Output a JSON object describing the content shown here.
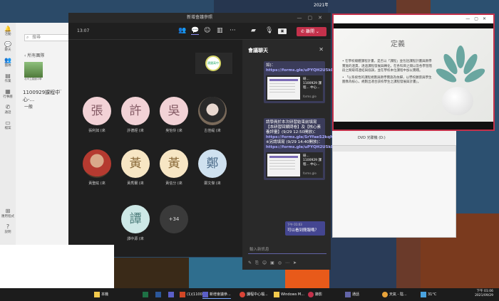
{
  "colors": {
    "accent": "#5b5fc7",
    "leave_red": "#c4314b",
    "chat_bubble": "#3b3c5a",
    "my_bubble": "#444691"
  },
  "desktop": {
    "top_date": "2021年09月"
  },
  "teams": {
    "search_placeholder": "搜尋",
    "rail": [
      {
        "icon": "bell-icon",
        "label": "活動"
      },
      {
        "icon": "chat-icon",
        "label": "聊天"
      },
      {
        "icon": "teams-icon",
        "label": "團隊"
      },
      {
        "icon": "assignments-icon",
        "label": "作業"
      },
      {
        "icon": "calendar-icon",
        "label": "行事曆"
      },
      {
        "icon": "phone-icon",
        "label": "通話"
      },
      {
        "icon": "files-icon",
        "label": "檔案"
      },
      {
        "icon": "apps-icon",
        "label": "應用程式"
      },
      {
        "icon": "help-icon",
        "label": "說明"
      }
    ],
    "back_label": "所有團隊",
    "team_logo_caption": "北市立建國中學",
    "team_name": "1100929課程中心-...",
    "channel": "一般"
  },
  "meeting": {
    "window_title": "新增會議參照",
    "timer": "13:07",
    "leave_label": "離開",
    "self_label": "建國高中",
    "participants": [
      {
        "char": "張",
        "name": "張利如 (來",
        "style": "av-pink"
      },
      {
        "char": "許",
        "name": "許德經 (來",
        "style": "av-pink"
      },
      {
        "char": "吳",
        "name": "吳怡伶 (來",
        "style": "av-pink"
      },
      {
        "char": "",
        "name": "古佳緹 (來",
        "style": "av-photo2"
      },
      {
        "char": "",
        "name": "黃聖紘 (來",
        "style": "av-photo"
      },
      {
        "char": "黃",
        "name": "黃秀爾 (來",
        "style": "av-cream"
      },
      {
        "char": "黃",
        "name": "黃信分 (來",
        "style": "av-cream"
      },
      {
        "char": "鄭",
        "name": "鄭文傑 (來",
        "style": "av-blue"
      },
      {
        "char": "譚",
        "name": "譚中源 (來",
        "style": "av-teal"
      },
      {
        "char": "+34",
        "name": "",
        "style": "av-more"
      }
    ]
  },
  "chat": {
    "title": "會議聊天",
    "msg1": {
      "pre": "如)：",
      "link": "https://forms.gle/uPYQH2U5kDkCwqtEA",
      "card_text": "研... 1100929 課程... 中心...",
      "card_domain": "forms.gle"
    },
    "msg2": {
      "text": "請學員於本次研習結束前填寫【本研習回饋問卷】及【核心素養評量】(9/29 12:50開放)：",
      "link1": "https://forms.gle/SrYfaeS2kqMpRUdW6",
      "mid": "※另請填寫 (9/29 14:40開放)：",
      "link2": "https://forms.gle/uPYQH2U5kDkCwqtEA",
      "card_text": "研... 1100929 課程... 中心...",
      "card_domain": "forms.gle"
    },
    "my_msg": {
      "time": "下午 01:03",
      "body": "可以看到簡報嗎？"
    },
    "input_placeholder": "輸入新訊息"
  },
  "ppt": {
    "slide_title": "定義",
    "bullets": [
      "在學校總體課程計畫，是否以「課程」並包括課程計畫與教學實施的連貫，透過課程發展與轉化，在各科目之間以及各學習階段之間取得連結與協調，並在學校本位課程中加以實踐。",
      "「以系統性的課程規劃與教學實施為依歸，以學校願景與學生圖像為核心，規劃出適合該校學生之課程發展與計畫」。"
    ]
  },
  "shelf": {
    "label": "DVD 光碟機 (D:)"
  },
  "taskbar": {
    "items": [
      {
        "label": "",
        "icon": "start-icon"
      },
      {
        "label": "本機",
        "icon": "explorer-icon"
      },
      {
        "label": "",
        "icon": "excel-icon"
      },
      {
        "label": "",
        "icon": "word-icon"
      },
      {
        "label": "",
        "icon": "teams-icon"
      },
      {
        "label": "(1)(1100...",
        "icon": "ppt-icon"
      },
      {
        "label": "新增會議參...",
        "icon": "teams-icon"
      },
      {
        "label": "課程中心檔...",
        "icon": "chrome-icon"
      },
      {
        "label": "Windows M...",
        "icon": "folder-icon"
      },
      {
        "label": "錄影",
        "icon": "record-icon"
      },
      {
        "label": "通話",
        "icon": "phone-icon"
      },
      {
        "label": "天氣 - 陰...",
        "icon": "weather-icon"
      },
      {
        "label": "31°C",
        "icon": "temp-icon"
      }
    ],
    "time": "下午 01:06",
    "date": "2021/09/29"
  }
}
